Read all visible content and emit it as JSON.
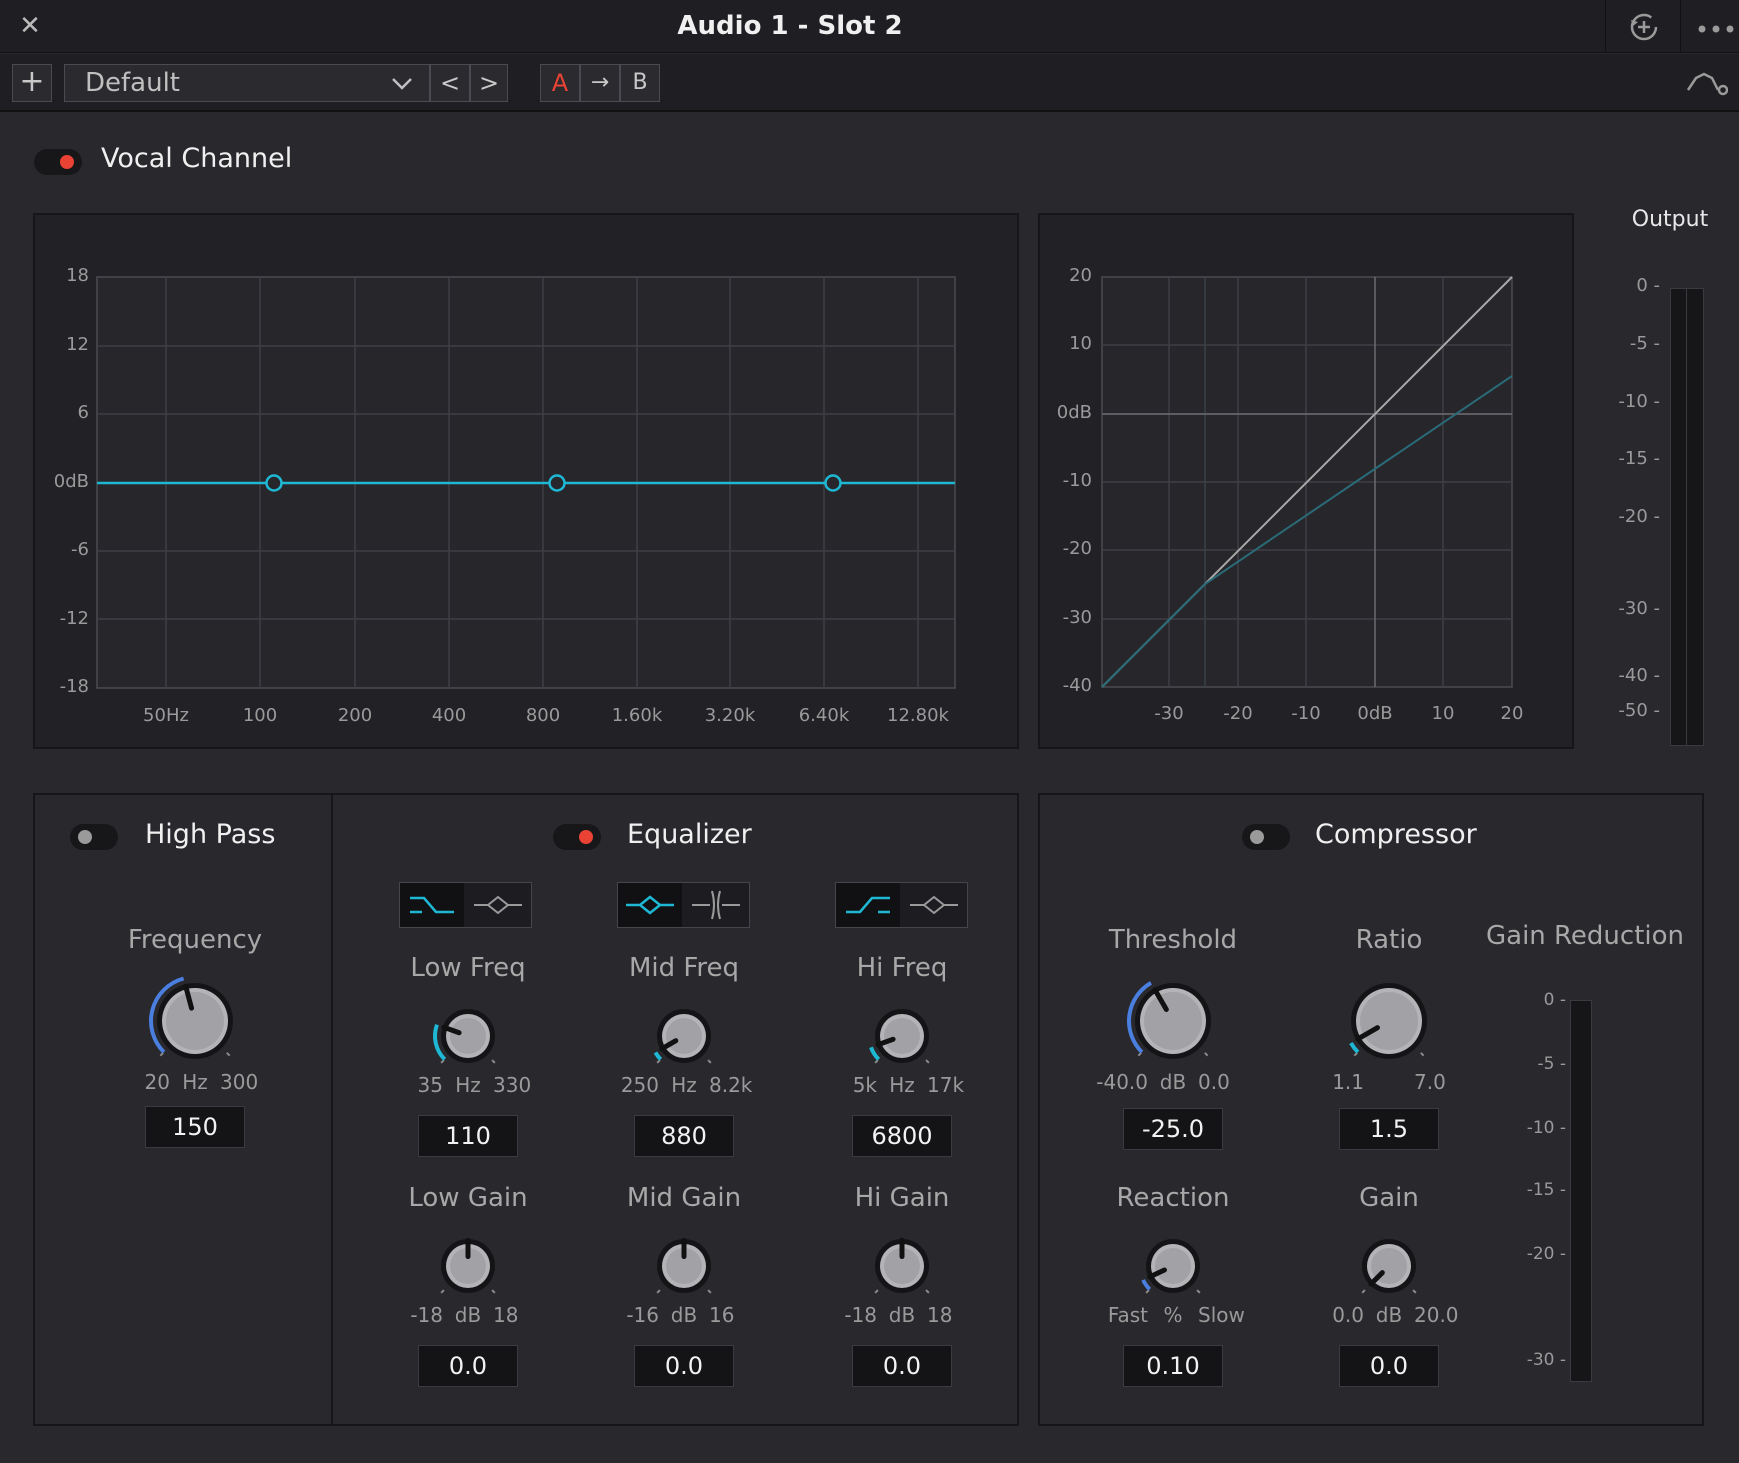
{
  "window": {
    "title": "Audio 1 - Slot 2",
    "close_icon": "close-icon",
    "reset_icon": "reset-icon",
    "more_icon": "more-icon"
  },
  "toolbar": {
    "add_label": "+",
    "preset_value": "Default",
    "prev_label": "<",
    "next_label": ">",
    "a_label": "A",
    "copy_label": "→",
    "b_label": "B"
  },
  "channel": {
    "name": "Vocal Channel",
    "enabled": true
  },
  "eq_graph": {
    "y_ticks": [
      "18",
      "12",
      "6",
      "0dB",
      "-6",
      "-12",
      "-18"
    ],
    "x_ticks": [
      "50Hz",
      "100",
      "200",
      "400",
      "800",
      "1.60k",
      "3.20k",
      "6.40k",
      "12.80k"
    ]
  },
  "comp_graph": {
    "y_ticks": [
      "20",
      "10",
      "0dB",
      "-10",
      "-20",
      "-30",
      "-40"
    ],
    "x_ticks": [
      "-30",
      "-20",
      "-10",
      "0dB",
      "10",
      "20"
    ]
  },
  "output": {
    "label": "Output",
    "ticks": [
      "0",
      "-5",
      "-10",
      "-15",
      "-20",
      "-30",
      "-40",
      "-50"
    ]
  },
  "high_pass": {
    "title": "High Pass",
    "enabled": false,
    "frequency": {
      "label": "Frequency",
      "min": "20",
      "unit": "Hz",
      "max": "300",
      "value": "150"
    }
  },
  "equalizer": {
    "title": "Equalizer",
    "enabled": true,
    "low_freq": {
      "label": "Low Freq",
      "min": "35",
      "unit": "Hz",
      "max": "330",
      "value": "110"
    },
    "mid_freq": {
      "label": "Mid Freq",
      "min": "250",
      "unit": "Hz",
      "max": "8.2k",
      "value": "880"
    },
    "hi_freq": {
      "label": "Hi Freq",
      "min": "5k",
      "unit": "Hz",
      "max": "17k",
      "value": "6800"
    },
    "low_gain": {
      "label": "Low Gain",
      "min": "-18",
      "unit": "dB",
      "max": "18",
      "value": "0.0"
    },
    "mid_gain": {
      "label": "Mid Gain",
      "min": "-16",
      "unit": "dB",
      "max": "16",
      "value": "0.0"
    },
    "hi_gain": {
      "label": "Hi Gain",
      "min": "-18",
      "unit": "dB",
      "max": "18",
      "value": "0.0"
    }
  },
  "compressor": {
    "title": "Compressor",
    "enabled": false,
    "threshold": {
      "label": "Threshold",
      "min": "-40.0",
      "unit": "dB",
      "max": "0.0",
      "value": "-25.0"
    },
    "ratio": {
      "label": "Ratio",
      "min": "1.1",
      "max": "7.0",
      "value": "1.5"
    },
    "reaction": {
      "label": "Reaction",
      "min": "Fast",
      "unit": "%",
      "max": "Slow",
      "value": "0.10"
    },
    "gain": {
      "label": "Gain",
      "min": "0.0",
      "unit": "dB",
      "max": "20.0",
      "value": "0.0"
    },
    "gain_reduction": {
      "label": "Gain Reduction",
      "ticks": [
        "0",
        "-5",
        "-10",
        "-15",
        "-20",
        "-30"
      ]
    }
  },
  "colors": {
    "accent": "#1fb8d4",
    "record_red": "#ea4335",
    "knob_arc": "#4a7fe0"
  }
}
